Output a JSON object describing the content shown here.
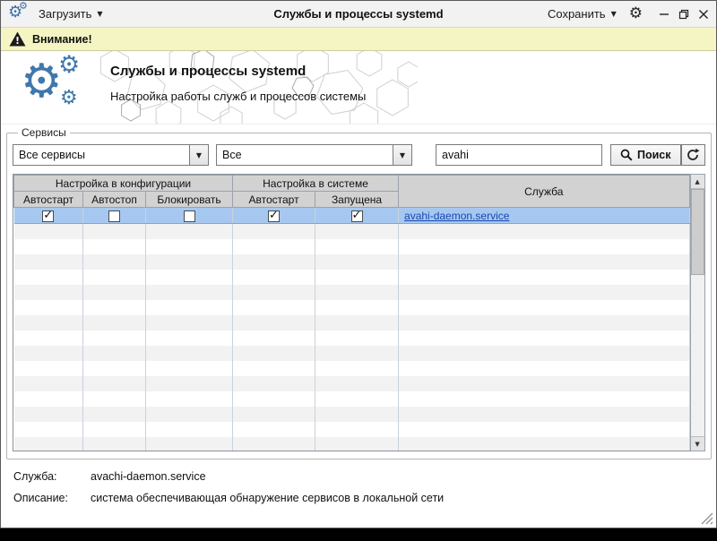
{
  "window": {
    "title": "Службы и процессы systemd",
    "load_label": "Загрузить",
    "save_label": "Сохранить"
  },
  "warning": {
    "label": "Внимание!"
  },
  "header": {
    "title": "Службы и процессы systemd",
    "subtitle": "Настройка работы служб и процессов системы"
  },
  "services_panel": {
    "legend": "Сервисы",
    "filter_service": {
      "value": "Все сервисы"
    },
    "filter_state": {
      "value": "Все"
    },
    "search": {
      "value": "avahi"
    },
    "search_button": "Поиск"
  },
  "table": {
    "group_headers": [
      "Настройка в конфигурации",
      "Настройка в системе",
      "Служба"
    ],
    "columns": [
      "Автостарт",
      "Автостоп",
      "Блокировать",
      "Автостарт",
      "Запущена"
    ],
    "rows": [
      {
        "checks": [
          true,
          false,
          false,
          true,
          true
        ],
        "service": "avahi-daemon.service",
        "selected": true
      }
    ],
    "empty_row_count": 15
  },
  "details": {
    "service_label": "Служба:",
    "service_value": "avachi-daemon.service",
    "description_label": "Описание:",
    "description_value": "система обеспечивающая обнаружение сервисов в локальной сети"
  },
  "colors": {
    "accent_blue": "#4178ab",
    "warning_bg": "#f5f5c3",
    "selected_row": "#a6c8f0",
    "link": "#1747b0",
    "header_gray": "#d2d2d2"
  }
}
